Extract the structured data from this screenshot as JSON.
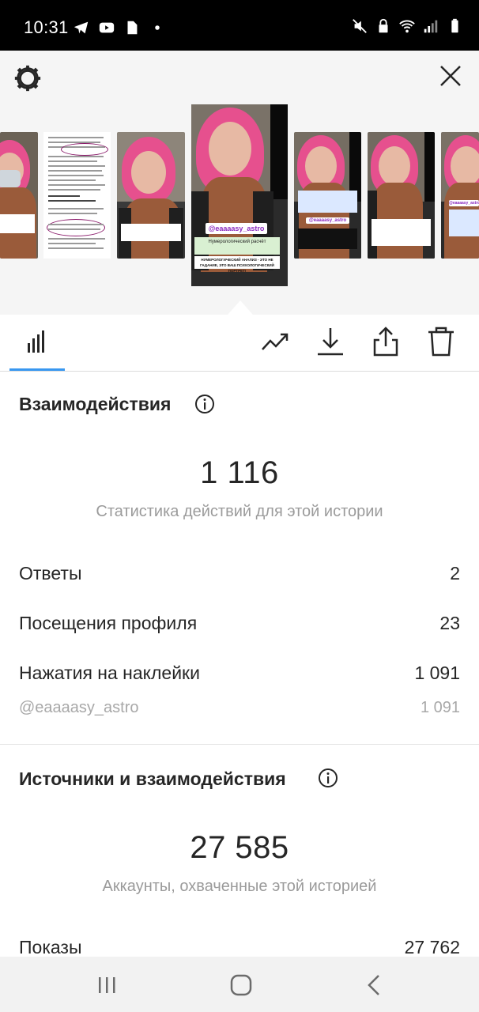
{
  "status_bar": {
    "time": "10:31",
    "left_icons": [
      "telegram-icon",
      "youtube-icon",
      "file-icon",
      "dot-icon"
    ],
    "right_icons": [
      "mute-icon",
      "lock-icon",
      "wifi-icon",
      "signal-icon",
      "battery-icon"
    ]
  },
  "header": {
    "settings_icon": "gear-icon",
    "close_icon": "close-icon"
  },
  "story_thumbnails": {
    "selected_tag": "@eaaaasy_astro",
    "selected_caption_1": "Нумерологический расчёт",
    "selected_caption_2": "НУМЕРОЛОГИЧЕСКИЙ АНАЛИЗ - ЭТО НЕ ГАДАНИЕ, ЭТО ВАШ ПСИХОЛОГИЧЕСКИЙ ПОРТРЕТ!",
    "thumb_tag": "@eaaaasy_astro"
  },
  "toolbar": {
    "icons": [
      "bar-chart-icon",
      "trending-icon",
      "download-icon",
      "share-icon",
      "trash-icon"
    ]
  },
  "interactions": {
    "title": "Взаимодействия",
    "total": "1 116",
    "subtitle": "Статистика действий для этой истории",
    "rows": [
      {
        "label": "Ответы",
        "value": "2"
      },
      {
        "label": "Посещения профиля",
        "value": "23"
      },
      {
        "label": "Нажатия на наклейки",
        "value": "1 091"
      }
    ],
    "sub_row": {
      "label": "@eaaaasy_astro",
      "value": "1 091"
    }
  },
  "sources": {
    "title": "Источники и взаимодействия",
    "total": "27 585",
    "subtitle": "Аккаунты, охваченные этой историей",
    "rows": [
      {
        "label": "Показы",
        "value": "27 762"
      }
    ]
  },
  "colors": {
    "accent": "#3897f0",
    "hair_pink": "#e6508e",
    "text": "#262626",
    "muted": "#9b9b9b"
  }
}
